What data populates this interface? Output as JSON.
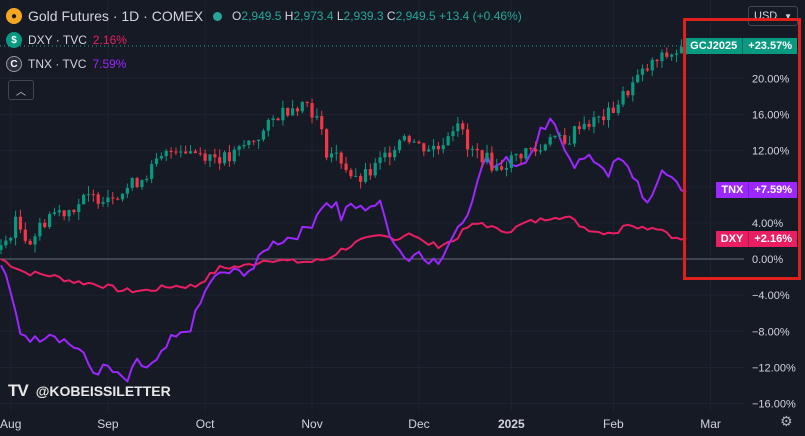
{
  "header": {
    "symbol": "Gold Futures · 1D · COMEX",
    "o_label": "O",
    "o": "2,949.5",
    "h_label": "H",
    "h": "2,973.4",
    "l_label": "L",
    "l": "2,939.3",
    "c_label": "C",
    "c": "2,949.5",
    "change": "+13.4 (+0.46%)"
  },
  "legend": [
    {
      "icon": "$",
      "name": "DXY · TVC",
      "value": "2.16%",
      "color": "#e91e63"
    },
    {
      "icon": "C",
      "name": "TNX · TVC",
      "value": "7.59%",
      "color": "#9c27ff"
    }
  ],
  "currency_label": "USD",
  "watermark": "@KOBEISSILETTER",
  "tv_logo": "TV",
  "price_tags": [
    {
      "name": "GCJ2025",
      "value": "+23.57%",
      "color": "#089981",
      "y_pct": 23.57
    },
    {
      "name": "TNX",
      "value": "+7.59%",
      "color": "#9c27ff",
      "y_pct": 7.59
    },
    {
      "name": "DXY",
      "value": "+2.16%",
      "color": "#e91e63",
      "y_pct": 2.16
    }
  ],
  "chart_data": {
    "type": "line",
    "ylim": [
      -17.5,
      25.5
    ],
    "y_ticks": [
      "20.00%",
      "16.00%",
      "12.00%",
      "8.00%",
      "4.00%",
      "0.00%",
      "−4.00%",
      "−8.00%",
      "−12.00%",
      "−16.00%"
    ],
    "y_tick_values": [
      20,
      16,
      12,
      8,
      4,
      0,
      -4,
      -8,
      -12,
      -16
    ],
    "x_ticks": [
      "Aug",
      "Sep",
      "Oct",
      "Nov",
      "Dec",
      "2025",
      "Feb",
      "Mar"
    ],
    "x_tick_index": [
      2,
      22,
      42,
      64,
      86,
      105,
      126,
      146
    ],
    "n_days": 150,
    "colors": {
      "up": "#089981",
      "down": "#f23645",
      "dxy": "#e91e63",
      "tnx": "#9c27ff",
      "grid": "#1f2330",
      "zero": "#6b6f7a",
      "dotted": "#26a69a"
    },
    "gold_anchors": [
      [
        0,
        1
      ],
      [
        3,
        4
      ],
      [
        6,
        2
      ],
      [
        10,
        5
      ],
      [
        14,
        5.5
      ],
      [
        17,
        6.5
      ],
      [
        21,
        7
      ],
      [
        25,
        7.5
      ],
      [
        29,
        9
      ],
      [
        33,
        11
      ],
      [
        36,
        12.5
      ],
      [
        39,
        12
      ],
      [
        43,
        11.5
      ],
      [
        47,
        11
      ],
      [
        50,
        12.5
      ],
      [
        54,
        14
      ],
      [
        57,
        16
      ],
      [
        60,
        17
      ],
      [
        63,
        17.3
      ],
      [
        65,
        15.5
      ],
      [
        67,
        12
      ],
      [
        70,
        11
      ],
      [
        73,
        8.5
      ],
      [
        76,
        9.5
      ],
      [
        80,
        12
      ],
      [
        83,
        14
      ],
      [
        86,
        12.5
      ],
      [
        90,
        12.3
      ],
      [
        92,
        14
      ],
      [
        94,
        15.5
      ],
      [
        96,
        12
      ],
      [
        99,
        11.5
      ],
      [
        102,
        10
      ],
      [
        105,
        11
      ],
      [
        108,
        12
      ],
      [
        111,
        12
      ],
      [
        113,
        14
      ],
      [
        116,
        12.5
      ],
      [
        119,
        15
      ],
      [
        122,
        15.2
      ],
      [
        125,
        16
      ],
      [
        128,
        18
      ],
      [
        131,
        20
      ],
      [
        134,
        21.5
      ],
      [
        137,
        22.5
      ],
      [
        140,
        23.1
      ],
      [
        141,
        23.57
      ]
    ],
    "dxy_anchors": [
      [
        0,
        0
      ],
      [
        5,
        -1.5
      ],
      [
        10,
        -1.8
      ],
      [
        15,
        -2.5
      ],
      [
        20,
        -2.8
      ],
      [
        25,
        -3.5
      ],
      [
        30,
        -3.5
      ],
      [
        35,
        -3
      ],
      [
        40,
        -3
      ],
      [
        45,
        -1
      ],
      [
        50,
        -0.8
      ],
      [
        55,
        0
      ],
      [
        60,
        -0.3
      ],
      [
        64,
        -0.3
      ],
      [
        67,
        0
      ],
      [
        70,
        1
      ],
      [
        74,
        2
      ],
      [
        78,
        2.5
      ],
      [
        82,
        2.3
      ],
      [
        84,
        3
      ],
      [
        87,
        1.8
      ],
      [
        90,
        1.5
      ],
      [
        93,
        2
      ],
      [
        96,
        3.5
      ],
      [
        99,
        4
      ],
      [
        102,
        3.2
      ],
      [
        105,
        3.2
      ],
      [
        108,
        4
      ],
      [
        111,
        4.3
      ],
      [
        114,
        4.8
      ],
      [
        117,
        4.5
      ],
      [
        120,
        3.5
      ],
      [
        123,
        3
      ],
      [
        127,
        3
      ],
      [
        129,
        4
      ],
      [
        132,
        3.5
      ],
      [
        135,
        3.5
      ],
      [
        137,
        3
      ],
      [
        139,
        2.2
      ],
      [
        141,
        2.16
      ]
    ],
    "tnx_anchors": [
      [
        0,
        -0.5
      ],
      [
        2,
        -4
      ],
      [
        4,
        -8
      ],
      [
        7,
        -9
      ],
      [
        10,
        -8
      ],
      [
        13,
        -9
      ],
      [
        16,
        -10
      ],
      [
        19,
        -12.5
      ],
      [
        22,
        -12
      ],
      [
        24,
        -13
      ],
      [
        26,
        -13.5
      ],
      [
        28,
        -11.5
      ],
      [
        30,
        -12
      ],
      [
        32,
        -11.5
      ],
      [
        35,
        -9
      ],
      [
        37,
        -8.5
      ],
      [
        39,
        -7.5
      ],
      [
        41,
        -5
      ],
      [
        43,
        -2.5
      ],
      [
        46,
        -1.5
      ],
      [
        49,
        -1.5
      ],
      [
        52,
        -1
      ],
      [
        55,
        1.5
      ],
      [
        57,
        2
      ],
      [
        60,
        2.5
      ],
      [
        62,
        3
      ],
      [
        64,
        4
      ],
      [
        66,
        6
      ],
      [
        69,
        6
      ],
      [
        70,
        4.5
      ],
      [
        72,
        6
      ],
      [
        74,
        5.5
      ],
      [
        76,
        6
      ],
      [
        78,
        6
      ],
      [
        80,
        3
      ],
      [
        82,
        1
      ],
      [
        84,
        -0.1
      ],
      [
        86,
        1
      ],
      [
        88,
        0
      ],
      [
        90,
        -0.5
      ],
      [
        92,
        1
      ],
      [
        93,
        3
      ],
      [
        96,
        5
      ],
      [
        98,
        9
      ],
      [
        100,
        11
      ],
      [
        102,
        10.3
      ],
      [
        104,
        11.5
      ],
      [
        106,
        10
      ],
      [
        108,
        11
      ],
      [
        110,
        12
      ],
      [
        111,
        14
      ],
      [
        113,
        15
      ],
      [
        114,
        14.5
      ],
      [
        116,
        12.5
      ],
      [
        118,
        10.5
      ],
      [
        120,
        11
      ],
      [
        122,
        11
      ],
      [
        124,
        10.2
      ],
      [
        125,
        9.5
      ],
      [
        127,
        11
      ],
      [
        129,
        10
      ],
      [
        131,
        8.5
      ],
      [
        133,
        6
      ],
      [
        134,
        6.5
      ],
      [
        136,
        10
      ],
      [
        138,
        9
      ],
      [
        139,
        8.5
      ],
      [
        141,
        7.59
      ]
    ]
  }
}
